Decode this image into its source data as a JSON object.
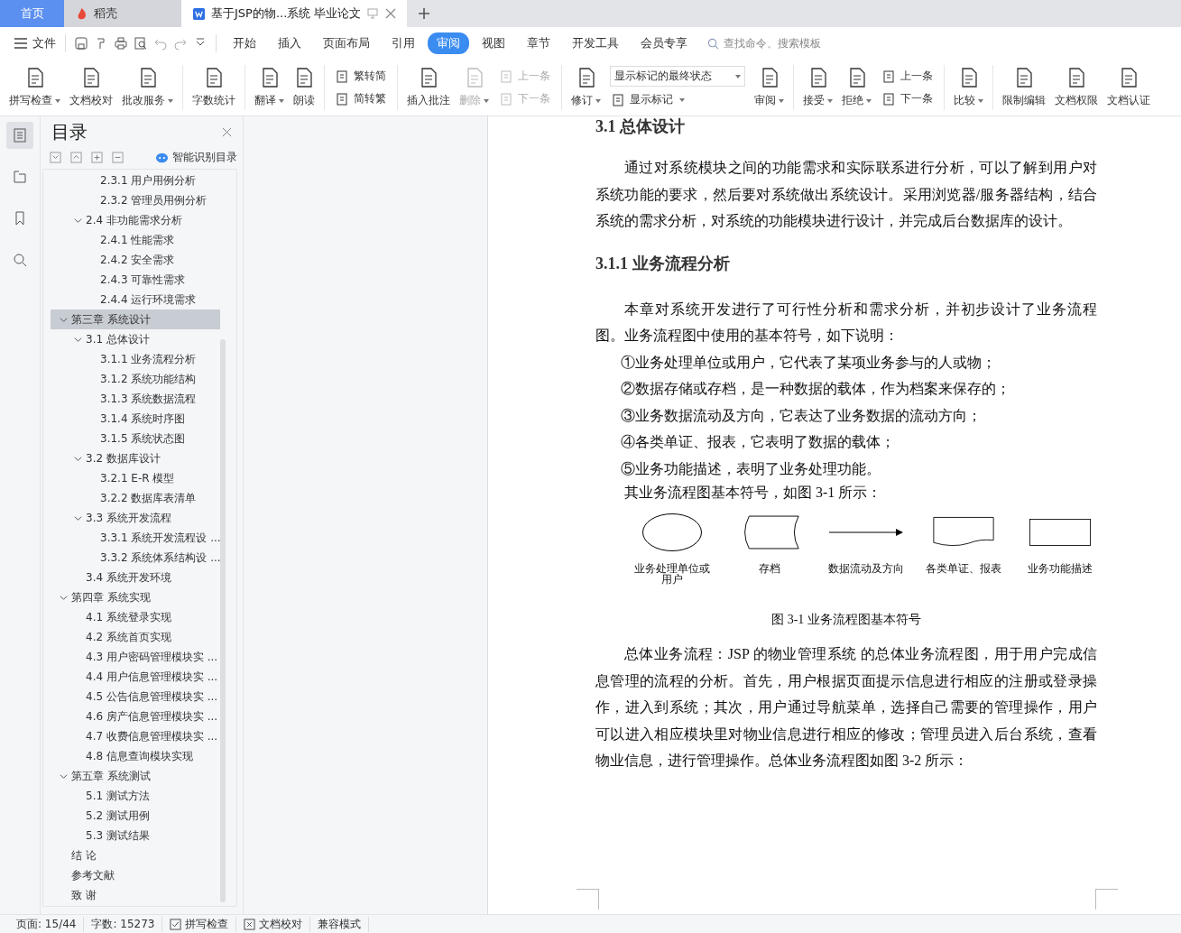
{
  "tabs": [
    {
      "label": "首页",
      "kind": "home",
      "selected": false
    },
    {
      "label": "稻壳",
      "kind": "app",
      "selected": false
    },
    {
      "label": "基于JSP的物...系统 毕业论文",
      "kind": "doc",
      "selected": true
    }
  ],
  "menu": {
    "file": "文件",
    "tabs": [
      {
        "label": "开始",
        "selected": false
      },
      {
        "label": "插入",
        "selected": false
      },
      {
        "label": "页面布局",
        "selected": false
      },
      {
        "label": "引用",
        "selected": false
      },
      {
        "label": "审阅",
        "selected": true
      },
      {
        "label": "视图",
        "selected": false
      },
      {
        "label": "章节",
        "selected": false
      },
      {
        "label": "开发工具",
        "selected": false
      },
      {
        "label": "会员专享",
        "selected": false
      }
    ],
    "search": {
      "placeholder": "查找命令、搜索模板"
    }
  },
  "ribbon": [
    [
      {
        "kind": "large",
        "label": "拼写检查",
        "dropdown": true,
        "disabled": false
      },
      {
        "kind": "large",
        "label": "文档校对",
        "dropdown": false,
        "disabled": false
      },
      {
        "kind": "large",
        "label": "批改服务",
        "dropdown": true,
        "disabled": false
      }
    ],
    [
      {
        "kind": "large",
        "label": "字数统计",
        "dropdown": false,
        "disabled": false
      }
    ],
    [
      {
        "kind": "large",
        "label": "翻译",
        "dropdown": true,
        "disabled": false
      },
      {
        "kind": "large",
        "label": "朗读",
        "dropdown": false,
        "disabled": false
      }
    ],
    [
      {
        "kind": "stack",
        "items": [
          {
            "kind": "small",
            "label": "繁转简",
            "dropdown": false,
            "disabled": false
          },
          {
            "kind": "small",
            "label": "简转繁",
            "dropdown": false,
            "disabled": false
          }
        ]
      }
    ],
    [
      {
        "kind": "large",
        "label": "插入批注",
        "dropdown": false,
        "disabled": false
      },
      {
        "kind": "large",
        "label": "删除",
        "dropdown": true,
        "disabled": true
      },
      {
        "kind": "stack",
        "items": [
          {
            "kind": "small",
            "label": "上一条",
            "dropdown": false,
            "disabled": true
          },
          {
            "kind": "small",
            "label": "下一条",
            "dropdown": false,
            "disabled": true
          }
        ]
      }
    ],
    [
      {
        "kind": "large",
        "label": "修订",
        "dropdown": true,
        "disabled": false
      },
      {
        "kind": "stack",
        "items": [
          {
            "kind": "select",
            "label": "显示标记的最终状态",
            "dropdown": true
          },
          {
            "kind": "small",
            "label": "显示标记",
            "dropdown": true,
            "disabled": false
          }
        ]
      },
      {
        "kind": "large",
        "label": "审阅",
        "dropdown": true,
        "disabled": false
      }
    ],
    [
      {
        "kind": "large",
        "label": "接受",
        "dropdown": true,
        "disabled": false
      },
      {
        "kind": "large",
        "label": "拒绝",
        "dropdown": true,
        "disabled": false
      },
      {
        "kind": "stack",
        "items": [
          {
            "kind": "small",
            "label": "上一条",
            "dropdown": false,
            "disabled": false
          },
          {
            "kind": "small",
            "label": "下一条",
            "dropdown": false,
            "disabled": false
          }
        ]
      }
    ],
    [
      {
        "kind": "large",
        "label": "比较",
        "dropdown": true,
        "disabled": false
      }
    ],
    [
      {
        "kind": "large",
        "label": "限制编辑",
        "dropdown": false,
        "disabled": false
      },
      {
        "kind": "large",
        "label": "文档权限",
        "dropdown": false,
        "disabled": false
      },
      {
        "kind": "large",
        "label": "文档认证",
        "dropdown": false,
        "disabled": false
      }
    ]
  ],
  "nav": {
    "title": "目录",
    "smart": "智能识别目录",
    "toc": [
      {
        "children": [
          {
            "children": [
              {
                "label": "2.3.1  用户用例分析",
                "selected": false
              },
              {
                "label": "2.3.2  管理员用例分析",
                "selected": false
              }
            ]
          },
          {
            "label": "2.4  非功能需求分析",
            "expanded": true,
            "selected": false,
            "children": [
              {
                "label": "2.4.1  性能需求",
                "selected": false
              },
              {
                "label": "2.4.2  安全需求",
                "selected": false
              },
              {
                "label": "2.4.3  可靠性需求",
                "selected": false
              },
              {
                "label": "2.4.4  运行环境需求",
                "selected": false
              }
            ]
          }
        ]
      },
      {
        "label": "第三章  系统设计",
        "expanded": true,
        "selected": true,
        "children": [
          {
            "label": "3.1  总体设计",
            "expanded": true,
            "selected": false,
            "children": [
              {
                "label": "3.1.1  业务流程分析",
                "selected": false
              },
              {
                "label": "3.1.2  系统功能结构",
                "selected": false
              },
              {
                "label": "3.1.3  系统数据流程",
                "selected": false
              },
              {
                "label": "3.1.4  系统时序图",
                "selected": false
              },
              {
                "label": "3.1.5  系统状态图",
                "selected": false
              }
            ]
          },
          {
            "label": "3.2  数据库设计",
            "expanded": true,
            "selected": false,
            "children": [
              {
                "label": "3.2.1 E-R 模型",
                "selected": false
              },
              {
                "label": "3.2.2  数据库表清单",
                "selected": false
              }
            ]
          },
          {
            "label": "3.3  系统开发流程",
            "expanded": true,
            "selected": false,
            "children": [
              {
                "label": "3.3.1  系统开发流程设 ...",
                "selected": false
              },
              {
                "label": "3.3.2  系统体系结构设 ...",
                "selected": false
              }
            ]
          },
          {
            "label": "3.4  系统开发环境",
            "selected": false
          }
        ]
      },
      {
        "label": "第四章  系统实现",
        "expanded": true,
        "selected": false,
        "children": [
          {
            "label": "4.1  系统登录实现",
            "selected": false
          },
          {
            "label": "4.2  系统首页实现",
            "selected": false
          },
          {
            "label": "4.3  用户密码管理模块实 ...",
            "selected": false
          },
          {
            "label": "4.4  用户信息管理模块实 ...",
            "selected": false
          },
          {
            "label": "4.5  公告信息管理模块实 ...",
            "selected": false
          },
          {
            "label": "4.6  房产信息管理模块实 ...",
            "selected": false
          },
          {
            "label": "4.7  收费信息管理模块实 ...",
            "selected": false
          },
          {
            "label": "4.8  信息查询模块实现",
            "selected": false
          }
        ]
      },
      {
        "label": "第五章  系统测试",
        "expanded": true,
        "selected": false,
        "children": [
          {
            "label": "5.1  测试方法",
            "selected": false
          },
          {
            "label": "5.2  测试用例",
            "selected": false
          },
          {
            "label": "5.3  测试结果",
            "selected": false
          }
        ]
      },
      {
        "label": "结      论",
        "selected": false
      },
      {
        "label": "参考文献",
        "selected": false
      },
      {
        "label": "致      谢",
        "selected": false
      }
    ]
  },
  "document": {
    "heading": "3.1  总体设计",
    "intro": "通过对系统模块之间的功能需求和实际联系进行分析，可以了解到用户对系统功能的要求，然后要对系统做出系统设计。采用浏览器/服务器结构，结合系统的需求分析，对系统的功能模块进行设计，并完成后台数据库的设计。",
    "subheading": "3.1.1  业务流程分析",
    "lead": "本章对系统开发进行了可行性分析和需求分析，并初步设计了业务流程图。业务流程图中使用的基本符号，如下说明：",
    "list": [
      "①业务处理单位或用户，它代表了某项业务参与的人或物；",
      "②数据存储或存档，是一种数据的载体，作为档案来保存的；",
      "③业务数据流动及方向，它表达了业务数据的流动方向；",
      "④各类单证、报表，它表明了数据的载体；",
      "⑤业务功能描述，表明了业务处理功能。"
    ],
    "figure_intro": "其业务流程图基本符号，如图 3-1 所示：",
    "figure": {
      "symbols": [
        {
          "kind": "ellipse",
          "label": "业务处理单位或用户"
        },
        {
          "kind": "storage",
          "label": "存档"
        },
        {
          "kind": "arrow",
          "label": "数据流动及方向"
        },
        {
          "kind": "document",
          "label": "各类单证、报表"
        },
        {
          "kind": "rect",
          "label": "业务功能描述"
        }
      ],
      "caption": "图 3-1 业务流程图基本符号"
    },
    "closing": "总体业务流程：JSP 的物业管理系统  的总体业务流程图，用于用户完成信息管理的流程的分析。首先，用户根据页面提示信息进行相应的注册或登录操作，进入到系统；其次，用户通过导航菜单，选择自己需要的管理操作，用户可以进入相应模块里对物业信息进行相应的修改；管理员进入后台系统，查看物业信息，进行管理操作。总体业务流程图如图 3-2 所示："
  },
  "status_bar": {
    "page": "页面: 15/44",
    "words": "字数: 15273",
    "spell": "拼写检查",
    "proof": "文档校对",
    "mode": "兼容模式"
  }
}
